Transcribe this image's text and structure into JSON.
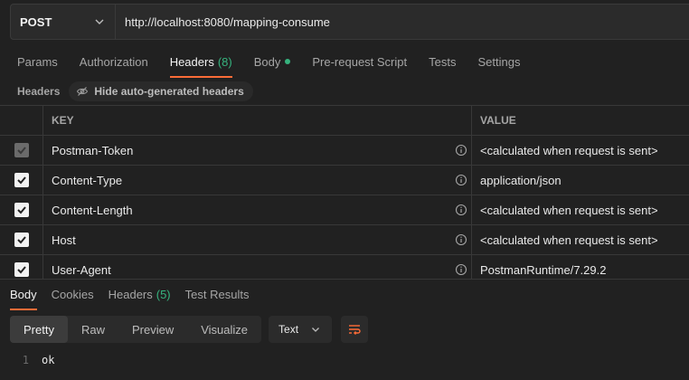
{
  "request": {
    "method": "POST",
    "url": "http://localhost:8080/mapping-consume"
  },
  "request_tabs": [
    {
      "label": "Params"
    },
    {
      "label": "Authorization"
    },
    {
      "label": "Headers",
      "count": "(8)"
    },
    {
      "label": "Body"
    },
    {
      "label": "Pre-request Script"
    },
    {
      "label": "Tests"
    },
    {
      "label": "Settings"
    }
  ],
  "headers_section": {
    "label": "Headers",
    "hide_button": "Hide auto-generated headers"
  },
  "table": {
    "columns": [
      "KEY",
      "VALUE"
    ],
    "rows": [
      {
        "key": "Postman-Token",
        "value": "<calculated when request is sent>",
        "checked": true,
        "disabled": true
      },
      {
        "key": "Content-Type",
        "value": "application/json",
        "checked": true,
        "disabled": false
      },
      {
        "key": "Content-Length",
        "value": "<calculated when request is sent>",
        "checked": true,
        "disabled": false
      },
      {
        "key": "Host",
        "value": "<calculated when request is sent>",
        "checked": true,
        "disabled": false
      },
      {
        "key": "User-Agent",
        "value": "PostmanRuntime/7.29.2",
        "checked": true,
        "disabled": false
      }
    ]
  },
  "response_tabs": [
    {
      "label": "Body"
    },
    {
      "label": "Cookies"
    },
    {
      "label": "Headers",
      "count": "(5)"
    },
    {
      "label": "Test Results"
    }
  ],
  "view_modes": [
    "Pretty",
    "Raw",
    "Preview",
    "Visualize"
  ],
  "format": "Text",
  "response_body": [
    {
      "line": "1",
      "text": "ok"
    }
  ],
  "colors": {
    "accent": "#ff6c37",
    "count_green": "#36b37e",
    "background": "#212121"
  }
}
